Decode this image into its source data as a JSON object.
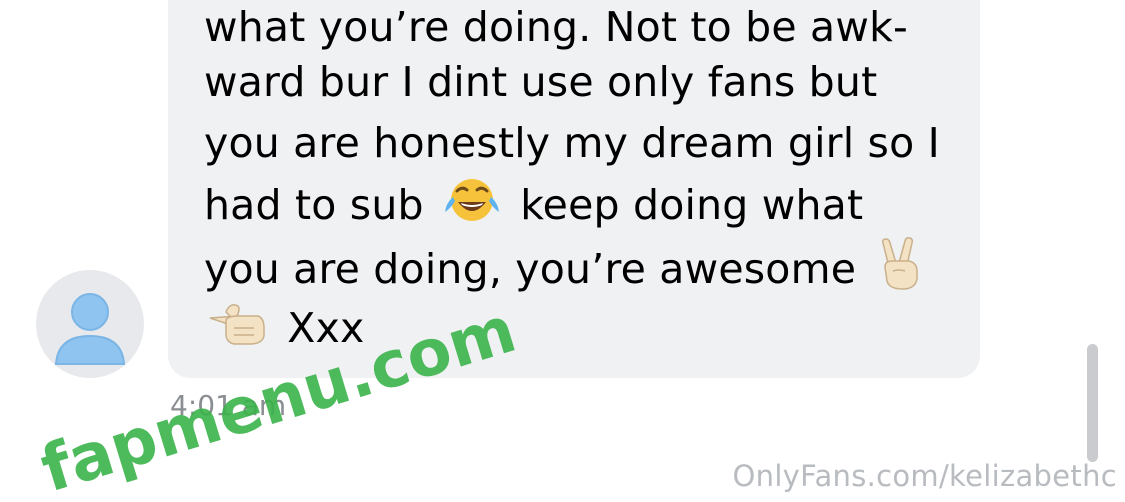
{
  "conversation": {
    "message": {
      "lines": [
        {
          "text": "what you’re doing. Not to be awk-"
        },
        {
          "text": "ward bur I dint use only fans but"
        },
        {
          "text": "you are honestly my dream girl so I"
        },
        {
          "before": "had to sub",
          "emoji": "face-with-tears-of-joy",
          "after": "keep doing what"
        },
        {
          "text": "you are doing, you’re awesome",
          "emoji": "victory-hand"
        },
        {
          "emoji": "backhand-index-pointing-left",
          "text": "Xxx"
        }
      ],
      "timestamp": "4:01 am"
    },
    "avatar": {
      "icon": "default-user-icon"
    }
  },
  "watermarks": {
    "site": "fapmenu.com",
    "footer": "OnlyFans.com/kelizabethc"
  },
  "colors": {
    "bubble": "#f0f1f3",
    "avatar_icon": "#8ec4ef",
    "timestamp": "#8a8d92",
    "site_watermark": "#3ab34a"
  }
}
